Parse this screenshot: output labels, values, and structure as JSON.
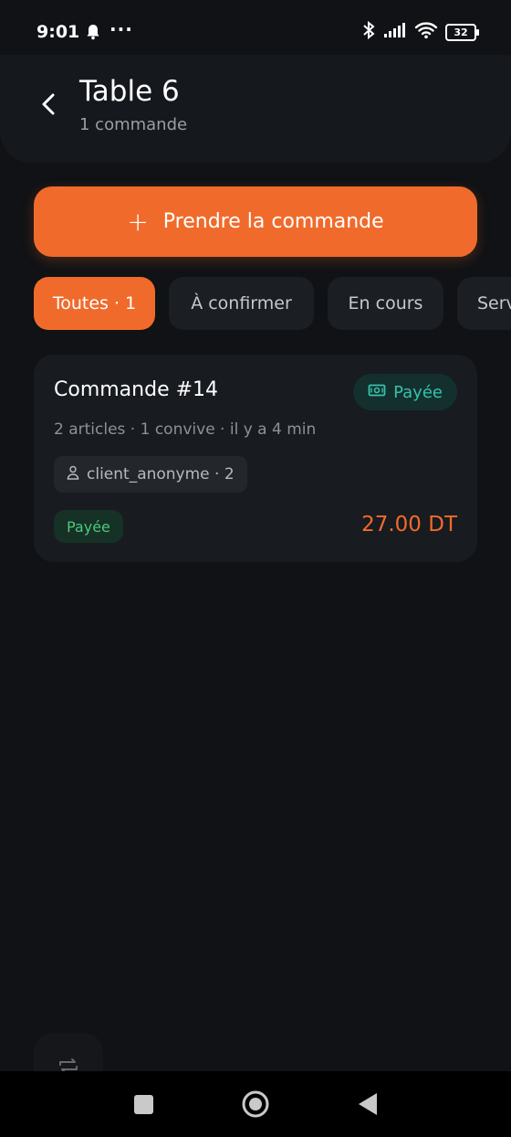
{
  "status_bar": {
    "time": "9:01",
    "battery": "32"
  },
  "header": {
    "title": "Table 6",
    "subtitle": "1 commande"
  },
  "cta": {
    "label": "Prendre la commande"
  },
  "filters": [
    {
      "label": "Toutes · 1",
      "active": true
    },
    {
      "label": "À confirmer",
      "active": false
    },
    {
      "label": "En cours",
      "active": false
    },
    {
      "label": "Servi",
      "active": false
    }
  ],
  "order": {
    "title": "Commande #14",
    "payment_badge": "Payée",
    "meta": "2 articles · 1 convive · il y a 4 min",
    "client": "client_anonyme · 2",
    "status": "Payée",
    "total": "27.00 DT"
  },
  "colors": {
    "accent": "#f06b2b",
    "background": "#101215",
    "card": "#181b20",
    "paid_teal": "#36c2ac",
    "paid_green": "#4cc879"
  },
  "icons": [
    "bell-icon",
    "more-icon",
    "bluetooth-icon",
    "signal-icon",
    "wifi-icon",
    "battery-icon",
    "back-arrow-icon",
    "plus-icon",
    "cash-icon",
    "user-icon",
    "switch-icon"
  ]
}
